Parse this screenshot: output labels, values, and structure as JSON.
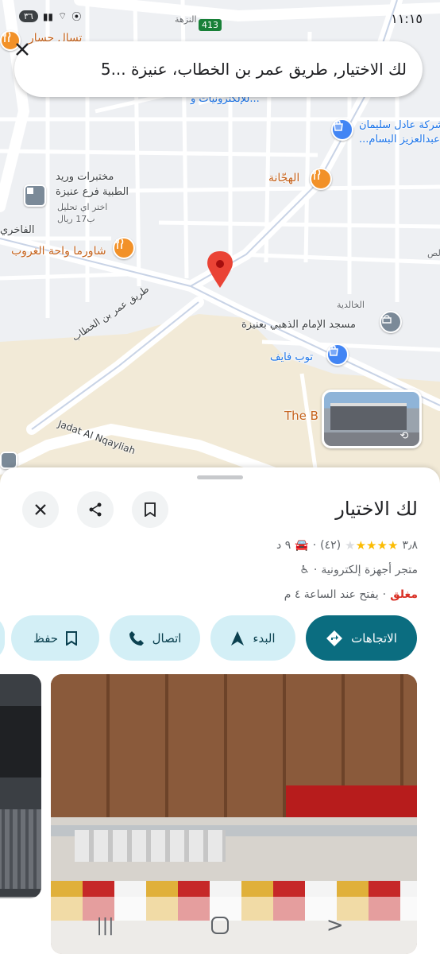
{
  "status_bar": {
    "time": "١١:١٥",
    "battery": "٣٦",
    "road_badge": "413"
  },
  "search": {
    "query": "لك الاختيار, طريق عمر بن الخطاب، عنيزة ...5"
  },
  "map": {
    "labels": {
      "top_road": "النزهة",
      "tasal_jassar": "تسال جسار",
      "electronics": "للإلكترونيات و...",
      "adel_line1": "شركة عادل سليمان",
      "adel_line2": "عبدالعزيز البسام...",
      "lab_line1": "مختبرات وريد",
      "lab_line2": "الطبية فرع عنيزة",
      "lab_line3": "اختر اي تحليل",
      "lab_line4": "ب17 ريال",
      "fakhiri": "الفاخري",
      "hajana": "الهجّانة",
      "shawarma": "شاورما واحة الغروب",
      "umar_road": "طريق عمر بن الخطاب",
      "khalidiya": "الخالدية",
      "mosque": "مسجد الإمام الذهبي بعنيزة",
      "toub": "توب فايف",
      "the_b": "The B",
      "jadat": "Jadat Al Nqayliah",
      "edge_lam": "لص"
    }
  },
  "place": {
    "name": "لك الاختيار",
    "rating": "٣٫٨",
    "rating_value": 3.8,
    "reviews": "(٤٢)",
    "drive_time": "٩ د",
    "category": "متجر أجهزة إلكترونية",
    "status": "مغلق",
    "hours": "يفتح عند الساعة ٤ م"
  },
  "actions": {
    "directions": "الاتجاهات",
    "start": "البدء",
    "call": "اتصال",
    "save": "حفظ"
  },
  "colors": {
    "primary": "#0b6d80",
    "chip": "#d3eff6",
    "closed": "#d93025",
    "star": "#fbbc04"
  }
}
